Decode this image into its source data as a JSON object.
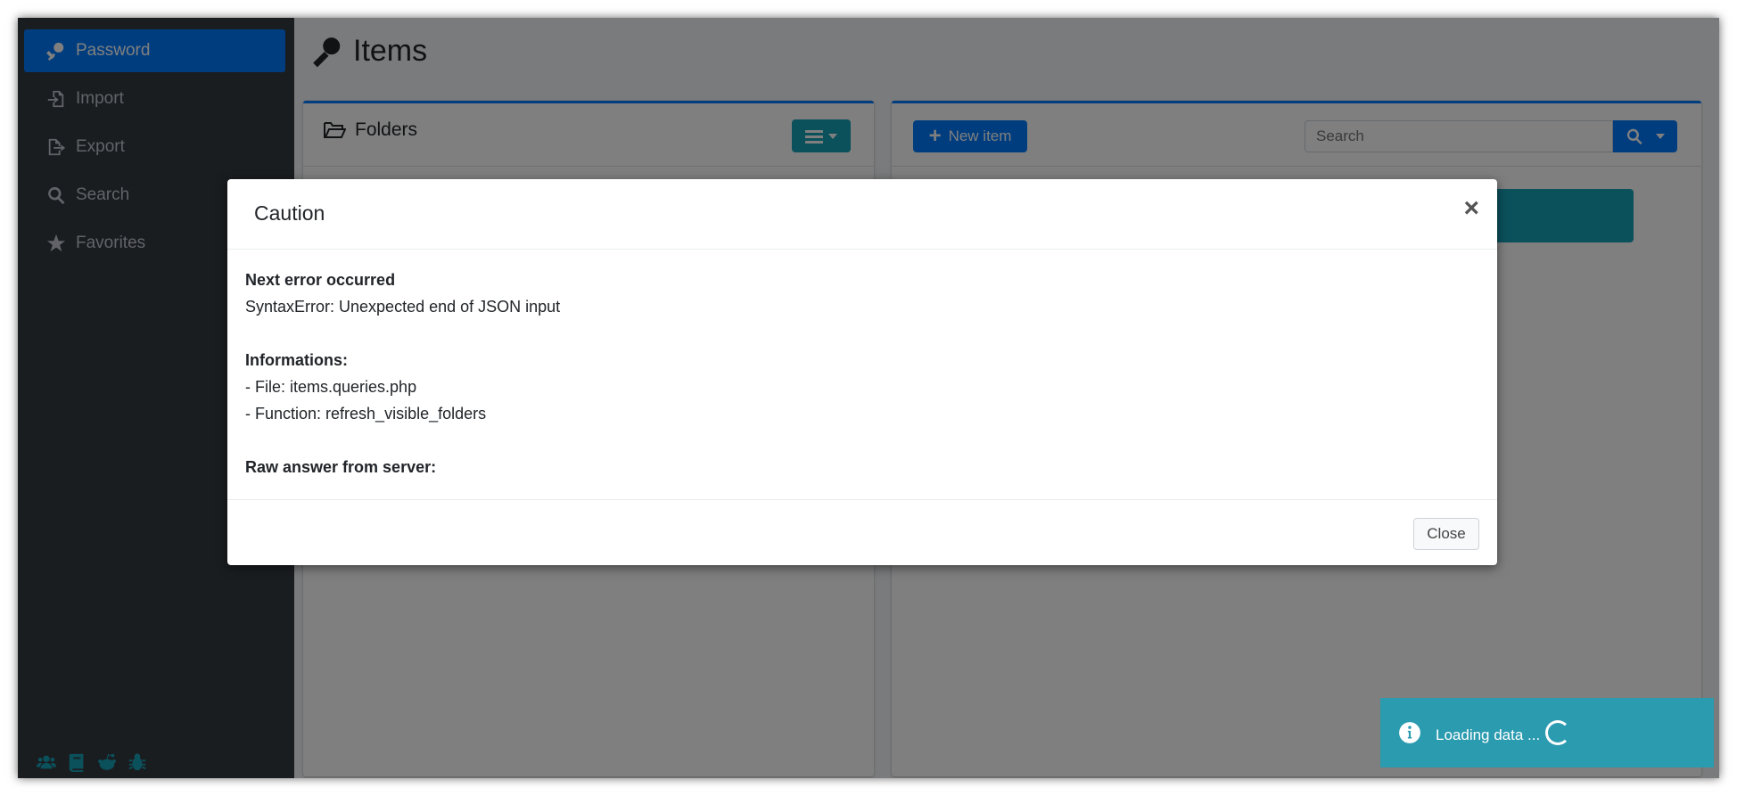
{
  "sidebar": {
    "items": [
      {
        "label": "Password",
        "icon": "key-icon",
        "active": true
      },
      {
        "label": "Import",
        "icon": "file-import-icon"
      },
      {
        "label": "Export",
        "icon": "file-export-icon"
      },
      {
        "label": "Search",
        "icon": "search-icon"
      },
      {
        "label": "Favorites",
        "icon": "star-icon"
      }
    ],
    "footer_icons": [
      "users-icon",
      "book-icon",
      "reddit-icon",
      "bug-icon"
    ]
  },
  "page": {
    "title": "Items",
    "icon": "key-icon"
  },
  "folders": {
    "title": "Folders"
  },
  "items_panel": {
    "new_item_label": "New item",
    "search_placeholder": "Search"
  },
  "modal": {
    "title": "Caution",
    "close_symbol": "×",
    "heading": "Next error occurred",
    "error": "SyntaxError: Unexpected end of JSON input",
    "info_heading": "Informations:",
    "file_line": "- File: items.queries.php",
    "function_line": "- Function: refresh_visible_folders",
    "raw_heading": "Raw answer from server:",
    "close_button": "Close"
  },
  "toast": {
    "message": "Loading data ..."
  },
  "colors": {
    "primary": "#007bff",
    "info": "#17a2b8",
    "sidebar": "#343a40",
    "toast": "#2b9bb0"
  }
}
